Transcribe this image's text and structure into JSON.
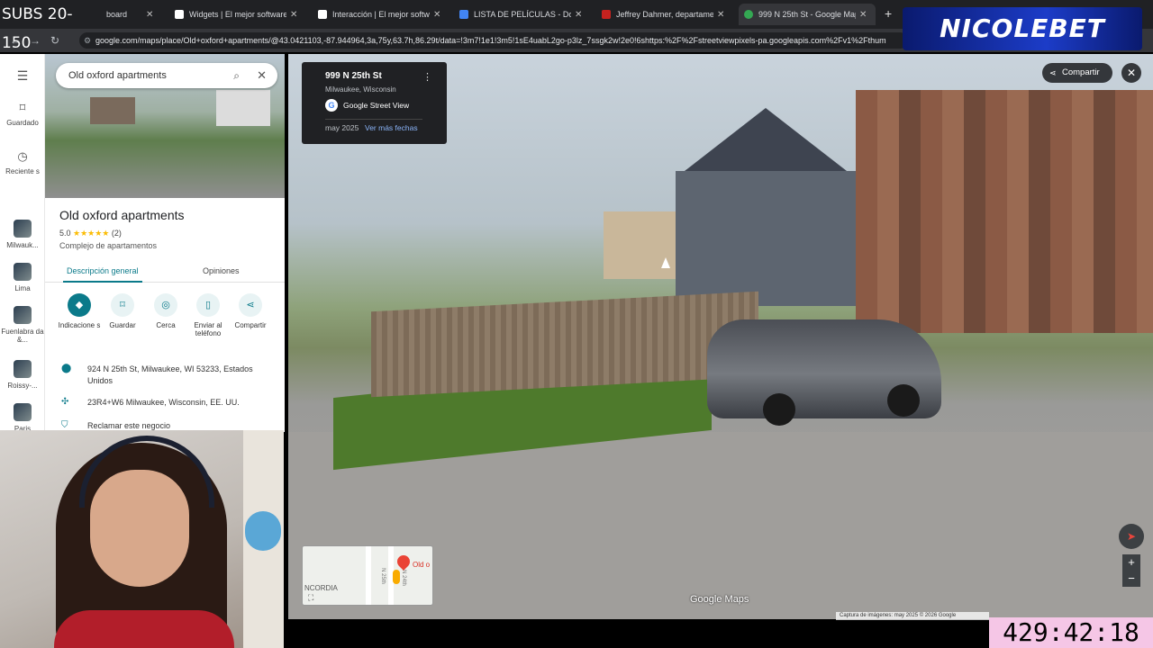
{
  "stream": {
    "subs_label": "SUBS 20- 150",
    "brand": "NICOLEBET",
    "timer": "429:42:18"
  },
  "tabs": [
    {
      "title": "board",
      "icon_color": "#ffffff",
      "icon": "partial-tab-icon"
    },
    {
      "title": "Widgets | El mejor software pa",
      "icon_color": "#ffffff",
      "icon": "widget-icon"
    },
    {
      "title": "Interacción | El mejor software",
      "icon_color": "#ffffff",
      "icon": "widget-icon"
    },
    {
      "title": "LISTA DE PELÍCULAS - Docume",
      "icon_color": "#4285f4",
      "icon": "docs-icon"
    },
    {
      "title": "Jeffrey Dahmer, departamento",
      "icon_color": "#c5221f",
      "icon": "news-icon"
    },
    {
      "title": "999 N 25th St - Google Maps",
      "icon_color": "#34a853",
      "icon": "maps-icon"
    }
  ],
  "address": {
    "url": "google.com/maps/place/Old+oxford+apartments/@43.0421103,-87.944964,3a,75y,63.7h,86.29t/data=!3m7!1e1!3m5!1sE4uabL2go-p3lz_7ssgk2w!2e0!6shttps:%2F%2Fstreetviewpixels-pa.googleapis.com%2Fv1%2Fthum"
  },
  "rail": {
    "menu": "☰",
    "saved": "Guardado",
    "recent": "Reciente s",
    "places": [
      "Milwauk...",
      "Lima",
      "Fuenlabra da &...",
      "Roissy-...",
      "Paris"
    ]
  },
  "search": {
    "query": "Old oxford apartments"
  },
  "place": {
    "name": "Old oxford apartments",
    "rating": "5.0",
    "stars": "★★★★★",
    "reviews": "(2)",
    "type": "Complejo de apartamentos",
    "tab_overview": "Descripción general",
    "tab_reviews": "Opiniones",
    "actions": [
      "Indicacione s",
      "Guardar",
      "Cerca",
      "Enviar al teléfono",
      "Compartir"
    ],
    "address": "924 N 25th St, Milwaukee, WI 53233, Estados Unidos",
    "plus_code": "23R4+W6 Milwaukee, Wisconsin, EE. UU.",
    "claim": "Reclamar este negocio"
  },
  "streetview": {
    "address": "999 N 25th St",
    "city": "Milwaukee, Wisconsin",
    "source": "Google Street View",
    "date": "may 2025",
    "more_dates": "Ver más fechas",
    "share": "Compartir",
    "watermark": "Google Maps",
    "credit": "Captura de imágenes: may 2025 © 2026 Google"
  },
  "minimap": {
    "area_label": "NCORDIA",
    "marker_label": "Old o",
    "street1": "N 25th",
    "street2": "N 24th"
  },
  "colors": {
    "accent": "#0b7a8a",
    "brand_blue": "#1c3cc8",
    "timer_bg": "#f5c6e6"
  }
}
